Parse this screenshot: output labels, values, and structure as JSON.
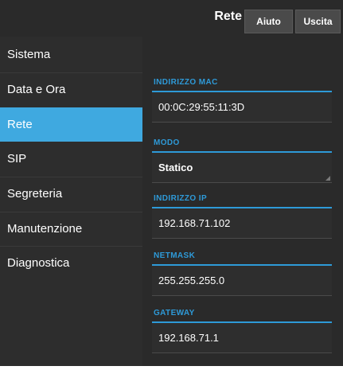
{
  "header": {
    "title": "Rete",
    "help_label": "Aiuto",
    "exit_label": "Uscita"
  },
  "sidebar": {
    "items": [
      {
        "label": "Sistema"
      },
      {
        "label": "Data e Ora"
      },
      {
        "label": "Rete"
      },
      {
        "label": "SIP"
      },
      {
        "label": "Segreteria"
      },
      {
        "label": "Manutenzione"
      },
      {
        "label": "Diagnostica"
      }
    ],
    "active": "Rete"
  },
  "fields": [
    {
      "label": "INDIRIZZO MAC",
      "value": "00:0C:29:55:11:3D"
    },
    {
      "label": "MODO",
      "value": "Statico"
    },
    {
      "label": "INDIRIZZO IP",
      "value": "192.168.71.102"
    },
    {
      "label": "NETMASK",
      "value": "255.255.255.0"
    },
    {
      "label": "GATEWAY",
      "value": "192.168.71.1"
    }
  ],
  "colors": {
    "accent": "#3fa9e0",
    "label": "#2e9ad8",
    "background": "#2a2a2a"
  }
}
